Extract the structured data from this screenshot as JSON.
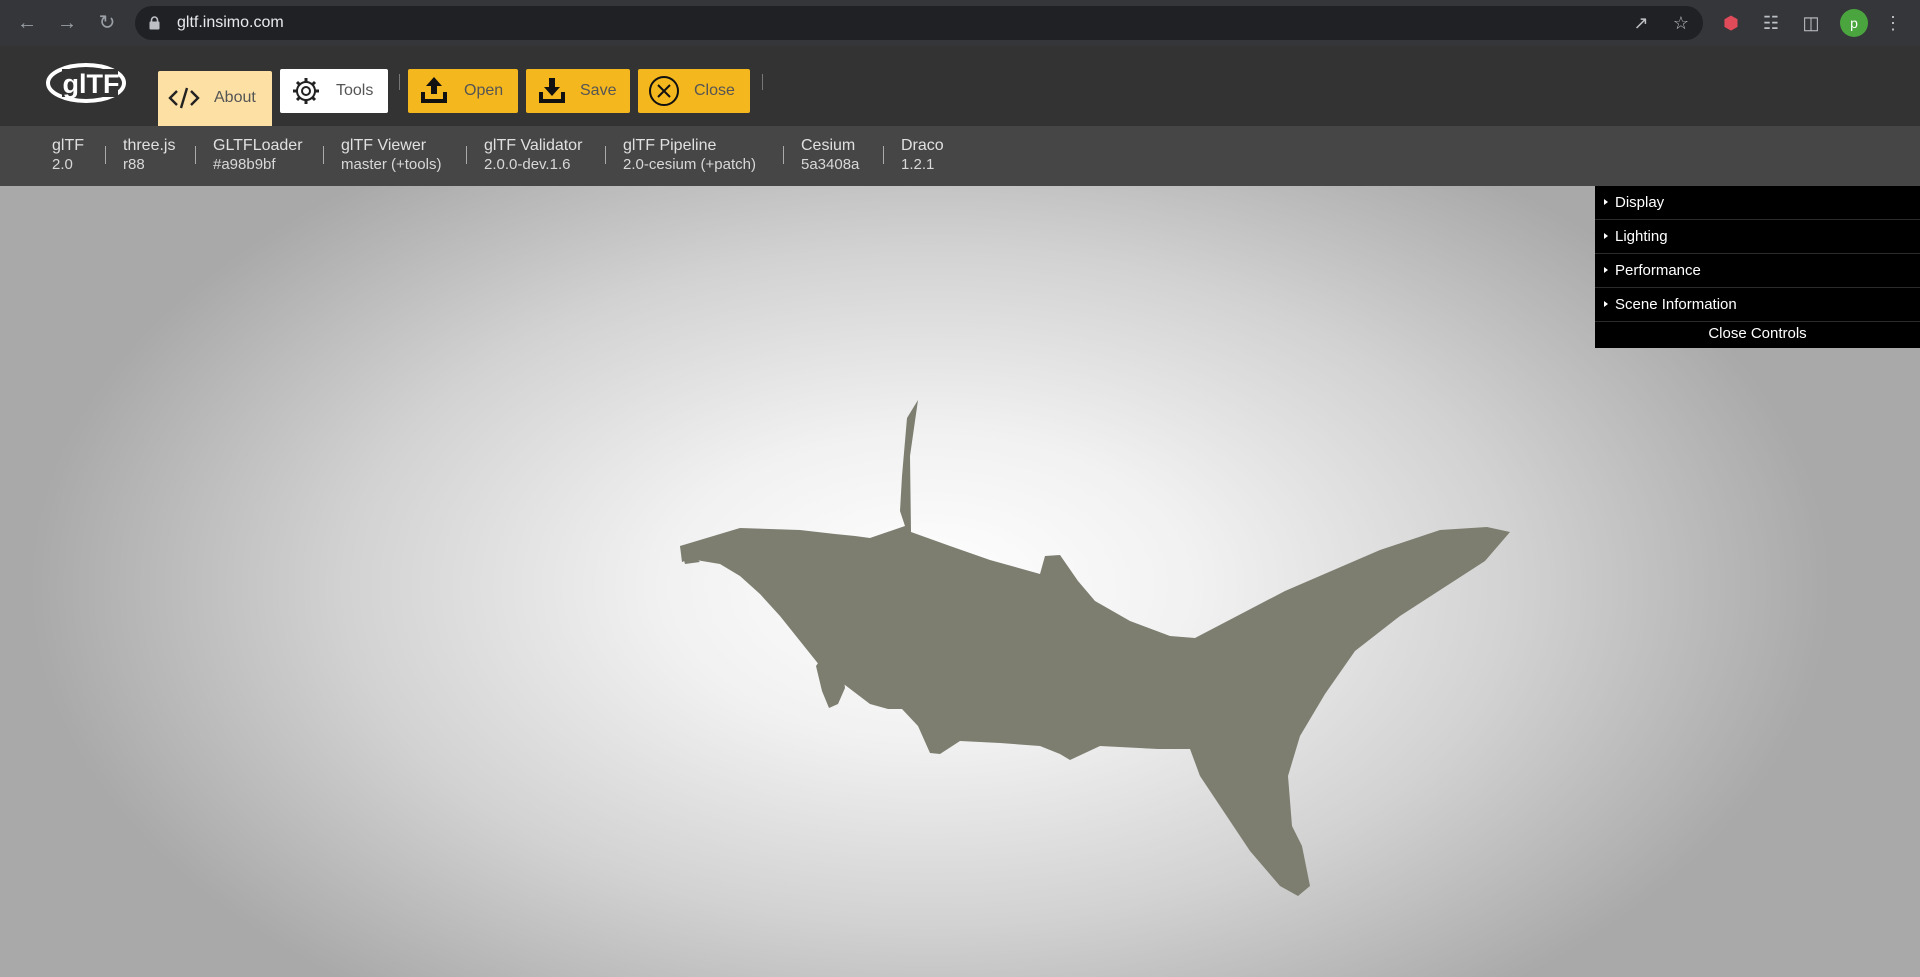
{
  "browser": {
    "url": "gltf.insimo.com",
    "profile_initial": "p",
    "icons": [
      "back-arrow-icon",
      "forward-arrow-icon",
      "reload-icon",
      "lock-icon",
      "share-icon",
      "star-icon",
      "extension-icon",
      "puzzle-icon",
      "sidepanel-icon",
      "kebab-menu-icon"
    ]
  },
  "app": {
    "logo_text": "glTF",
    "buttons": {
      "about": "About",
      "tools": "Tools",
      "open": "Open",
      "save": "Save",
      "close": "Close"
    },
    "colors": {
      "accent": "#f4b71d",
      "about_active": "#fce0a4",
      "model": "#7d7e70"
    }
  },
  "versions": [
    {
      "name": "glTF",
      "value": "2.0"
    },
    {
      "name": "three.js",
      "value": "r88"
    },
    {
      "name": "GLTFLoader",
      "value": "#a98b9bf"
    },
    {
      "name": "glTF Viewer",
      "value": "master (+tools)"
    },
    {
      "name": "glTF Validator",
      "value": "2.0.0-dev.1.6"
    },
    {
      "name": "glTF Pipeline",
      "value": "2.0-cesium (+patch)"
    },
    {
      "name": "Cesium",
      "value": "5a3408a"
    },
    {
      "name": "Draco",
      "value": "1.2.1"
    }
  ],
  "controls": {
    "folders": [
      "Display",
      "Lighting",
      "Performance",
      "Scene Information"
    ],
    "close_label": "Close Controls"
  }
}
